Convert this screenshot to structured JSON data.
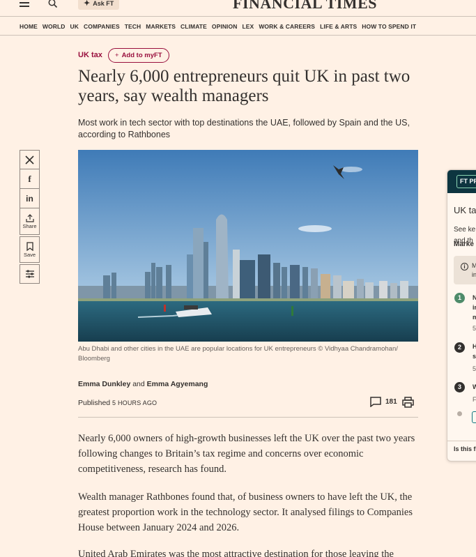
{
  "header": {
    "logo": "FINANCIAL TIMES",
    "ask_ft_label": "Ask FT"
  },
  "nav": {
    "items": [
      "HOME",
      "WORLD",
      "UK",
      "COMPANIES",
      "TECH",
      "MARKETS",
      "CLIMATE",
      "OPINION",
      "LEX",
      "WORK & CAREERS",
      "LIFE & ARTS",
      "HOW TO SPEND IT"
    ]
  },
  "article": {
    "tag": "UK tax",
    "add_myft_label": "Add to myFT",
    "headline": "Nearly 6,000 entrepreneurs quit UK in past two years, say wealth managers",
    "standfirst": "Most work in tech sector with top destinations the UAE, followed by Spain and the US, according to Rathbones",
    "caption": "Abu Dhabi and other cities in the UAE are popular locations for UK entrepreneurs © Vidhyaa Chandramohan/ Bloomberg",
    "author1": "Emma Dunkley",
    "byline_and": "and",
    "author2": "Emma Agyemang",
    "published_label": "Published",
    "published_time": "5 HOURS AGO",
    "comment_count": "181",
    "paragraphs": [
      "Nearly 6,000 owners of high-growth businesses left the UK over the past two years following changes to Britain’s tax regime and concerns over economic competitiveness, research has found.",
      "Wealth manager Rathbones found that, of business owners to have left the UK, the greatest proportion work in the technology sector. It analysed filings to Companies House between January 2024 and 2026.",
      "United Arab Emirates was the most attractive destination for those leaving the"
    ]
  },
  "share": {
    "x_icon": "x-icon",
    "facebook_icon": "facebook-icon",
    "linkedin_icon": "linkedin-icon",
    "share_label": "Share",
    "save_label": "Save"
  },
  "panel": {
    "badge": "FT PR",
    "title": "UK ta",
    "sub_line1": "See ke",
    "sub_line2": "and th",
    "section": "Marke",
    "info_line1": "M",
    "info_line2": "in",
    "items": [
      {
        "num": "1",
        "lines": [
          "N",
          "in",
          "m"
        ],
        "meta": "5"
      },
      {
        "num": "2",
        "lines": [
          "H",
          "s"
        ],
        "meta": "5"
      },
      {
        "num": "3",
        "lines": [
          "W"
        ],
        "meta": "F"
      }
    ],
    "footer": "Is this f",
    "colors": {
      "item1": "#4e8b6a",
      "item2": "#33302e",
      "item3": "#33302e"
    }
  }
}
